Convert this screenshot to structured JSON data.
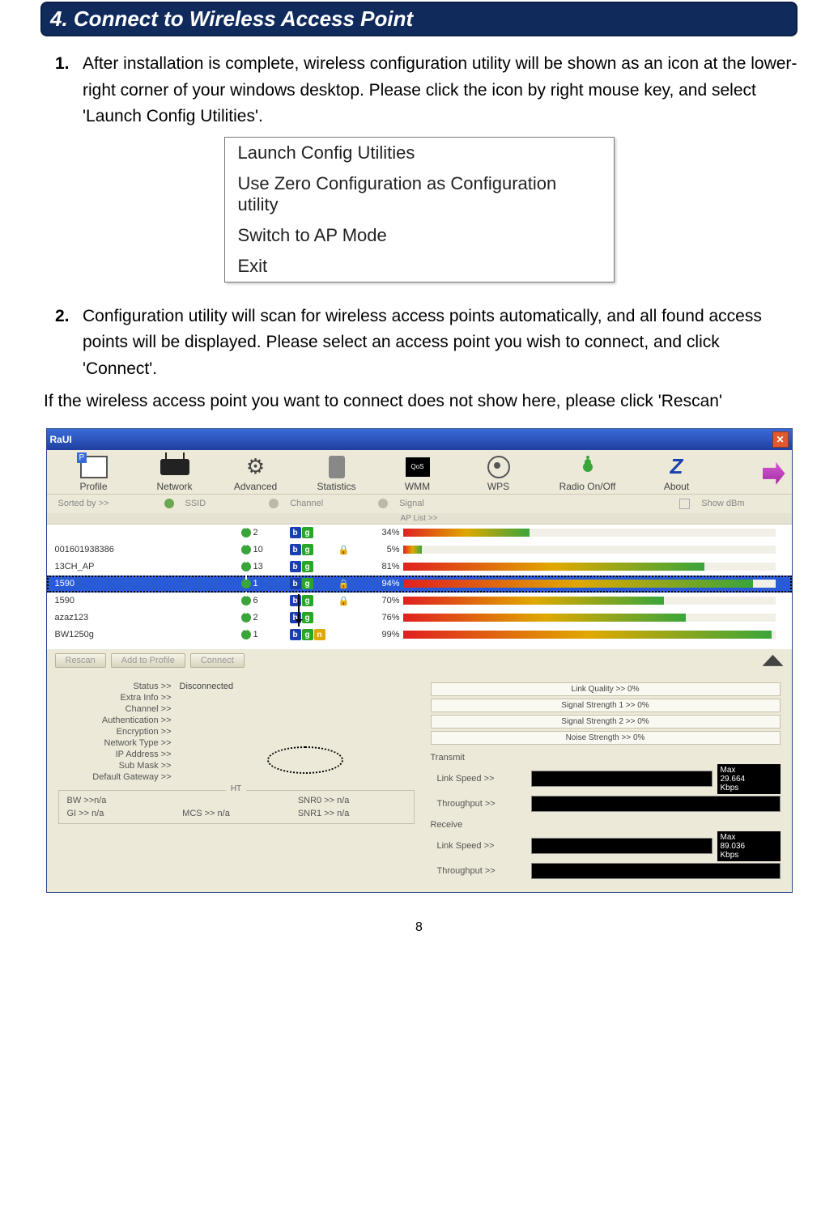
{
  "heading": "4. Connect to Wireless Access Point",
  "step1_num": "1.",
  "step1_text": "After installation is complete, wireless configuration utility will be shown as an icon at the lower-right corner of your windows desktop. Please click the icon by right mouse key, and select 'Launch Config Utilities'.",
  "context_menu": {
    "item1": "Launch Config Utilities",
    "item2": "Use Zero Configuration as Configuration utility",
    "item3": "Switch to AP Mode",
    "item4": "Exit"
  },
  "step2_num": "2.",
  "step2_text": "Configuration utility will scan for wireless access points automatically, and all found access points will be displayed. Please select an access point you wish to connect, and click 'Connect'.",
  "note_text": "If the wireless access point you want to connect does not show here, please click 'Rescan'",
  "raui": {
    "title": "RaUI",
    "toolbar": {
      "profile": "Profile",
      "network": "Network",
      "advanced": "Advanced",
      "statistics": "Statistics",
      "wmm": "WMM",
      "wps": "WPS",
      "radio": "Radio On/Off",
      "about": "About"
    },
    "sort": {
      "label": "Sorted by >>",
      "ssid": "SSID",
      "channel": "Channel",
      "signal": "Signal",
      "showdbm": "Show dBm"
    },
    "aplisthdr": "AP List >>",
    "aplist": [
      {
        "ssid": "",
        "ch": "2",
        "modes": [
          "b",
          "g"
        ],
        "enc": "",
        "pct": "34%",
        "barw": "34%",
        "sel": false
      },
      {
        "ssid": "001601938386",
        "ch": "10",
        "modes": [
          "b",
          "g"
        ],
        "enc": "🔒",
        "pct": "5%",
        "barw": "5%",
        "sel": false
      },
      {
        "ssid": "13CH_AP",
        "ch": "13",
        "modes": [
          "b",
          "g"
        ],
        "enc": "",
        "pct": "81%",
        "barw": "81%",
        "sel": false
      },
      {
        "ssid": "1590",
        "ch": "1",
        "modes": [
          "b",
          "g"
        ],
        "enc": "🔒",
        "pct": "94%",
        "barw": "94%",
        "sel": true
      },
      {
        "ssid": "1590",
        "ch": "6",
        "modes": [
          "b",
          "g"
        ],
        "enc": "🔒",
        "pct": "70%",
        "barw": "70%",
        "sel": false
      },
      {
        "ssid": "azaz123",
        "ch": "2",
        "modes": [
          "b",
          "g"
        ],
        "enc": "",
        "pct": "76%",
        "barw": "76%",
        "sel": false
      },
      {
        "ssid": "BW1250g",
        "ch": "1",
        "modes": [
          "b",
          "g",
          "n"
        ],
        "enc": "",
        "pct": "99%",
        "barw": "99%",
        "sel": false
      }
    ],
    "actions": {
      "rescan": "Rescan",
      "addprofile": "Add to Profile",
      "connect": "Connect"
    },
    "details": {
      "left": {
        "status_l": "Status >>",
        "status_v": "Disconnected",
        "extra_l": "Extra Info >>",
        "extra_v": "",
        "channel_l": "Channel >>",
        "channel_v": "",
        "auth_l": "Authentication >>",
        "auth_v": "",
        "enc_l": "Encryption >>",
        "enc_v": "",
        "net_l": "Network Type >>",
        "net_v": "",
        "ip_l": "IP Address >>",
        "ip_v": "",
        "sub_l": "Sub Mask >>",
        "sub_v": "",
        "gw_l": "Default Gateway >>",
        "gw_v": ""
      },
      "ht": {
        "title": "HT",
        "bw": "BW >>n/a",
        "gi": "GI >> n/a",
        "mcs": "MCS >>  n/a",
        "snr0": "SNR0 >>  n/a",
        "snr1": "SNR1 >>  n/a"
      },
      "quality": {
        "lq": "Link Quality >> 0%",
        "ss1": "Signal Strength 1 >> 0%",
        "ss2": "Signal Strength 2 >> 0%",
        "ns": "Noise Strength >> 0%"
      },
      "transmit_hdr": "Transmit",
      "receive_hdr": "Receive",
      "tx": {
        "ls_l": "Link Speed >>",
        "tp_l": "Throughput >>",
        "max_l": "Max",
        "max_v": "29.664",
        "unit": "Kbps"
      },
      "rx": {
        "ls_l": "Link Speed >>",
        "tp_l": "Throughput >>",
        "max_l": "Max",
        "max_v": "89.036",
        "unit": "Kbps"
      }
    }
  },
  "pageno": "8",
  "qos_label": "QoS"
}
